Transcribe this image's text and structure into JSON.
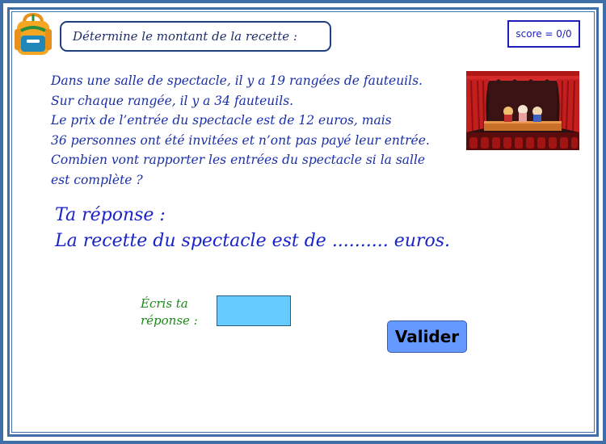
{
  "header": {
    "title": "Détermine le montant de la recette :",
    "score": "score = 0/0"
  },
  "problem": {
    "lines": [
      "Dans une salle de spectacle, il y a 19 rangées de fauteuils.",
      "Sur chaque rangée, il y a 34 fauteuils.",
      "Le prix de l’entrée du spectacle est de 12 euros, mais",
      "36 personnes ont été invitées et n’ont pas payé leur entrée.",
      "Combien vont rapporter les entrées du spectacle si la salle",
      "est complète ?"
    ]
  },
  "answer": {
    "heading": "Ta réponse :",
    "sentence": "La recette du spectacle est de .......... euros."
  },
  "input": {
    "label_line1": "Écris ta",
    "label_line2": "réponse :",
    "value": ""
  },
  "button": {
    "label": "Valider",
    "color": "#6699ff"
  },
  "images": {
    "icon": "backpack-icon",
    "illustration": "theater-stage-image"
  },
  "colors": {
    "frame": "#3f6fa8",
    "problem_text": "#1a2fa6",
    "answer_text": "#1a23c9",
    "label_text": "#1b8a1b",
    "input_bg": "#66ccff"
  }
}
